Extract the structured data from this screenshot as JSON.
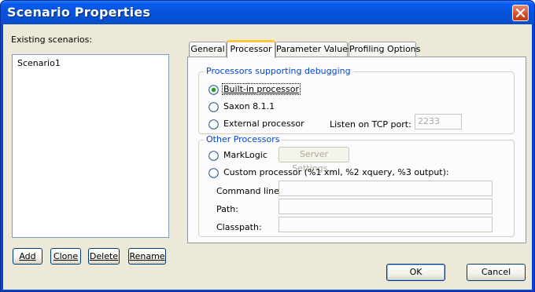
{
  "window": {
    "title": "Scenario Properties"
  },
  "scenarios": {
    "label": "Existing scenarios:",
    "items": [
      "Scenario1"
    ],
    "buttons": {
      "add": "Add",
      "clone": "Clone",
      "delete": "Delete",
      "rename": "Rename"
    }
  },
  "tabs": [
    {
      "label": "General",
      "active": false
    },
    {
      "label": "Processor",
      "active": true
    },
    {
      "label": "Parameter Values",
      "active": false
    },
    {
      "label": "Profiling Options",
      "active": false
    }
  ],
  "debugging": {
    "title": "Processors supporting debugging",
    "builtin": "Built-in processor",
    "saxon": "Saxon 8.1.1",
    "external": "External processor",
    "tcp_label": "Listen on TCP port:",
    "tcp_value": "2233"
  },
  "other": {
    "title": "Other Processors",
    "marklogic": "MarkLogic",
    "server_settings": "Server Settings...",
    "custom": "Custom processor (%1 xml, %2 xquery, %3 output):",
    "command_line_label": "Command line:",
    "path_label": "Path:",
    "classpath_label": "Classpath:",
    "command_line_value": "",
    "path_value": "",
    "classpath_value": ""
  },
  "dialog_buttons": {
    "ok": "OK",
    "cancel": "Cancel"
  },
  "colors": {
    "title_bar": "#0553d8",
    "group_title": "#0046d5",
    "tab_highlight": "#ffc83c",
    "close_button": "#d44d2a"
  }
}
